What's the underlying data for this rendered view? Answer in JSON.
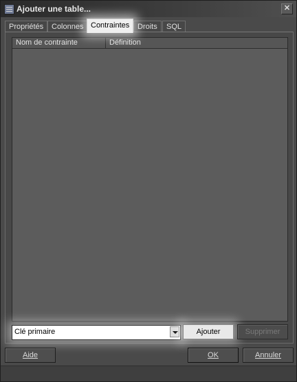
{
  "window": {
    "title": "Ajouter une table..."
  },
  "tabs": [
    {
      "label": "Propriétés",
      "active": false
    },
    {
      "label": "Colonnes",
      "active": false
    },
    {
      "label": "Contraintes",
      "active": true
    },
    {
      "label": "Droits",
      "active": false
    },
    {
      "label": "SQL",
      "active": false
    }
  ],
  "constraints_list": {
    "columns": [
      "Nom de contrainte",
      "Définition"
    ],
    "rows": []
  },
  "constraint_type": {
    "selected": "Clé primaire"
  },
  "buttons": {
    "add": "Ajouter",
    "delete": "Supprimer",
    "help": "Aide",
    "ok": "OK",
    "cancel": "Annuler"
  },
  "icons": {
    "app": "table-icon",
    "close": "close-icon",
    "dropdown": "chevron-down-icon"
  }
}
